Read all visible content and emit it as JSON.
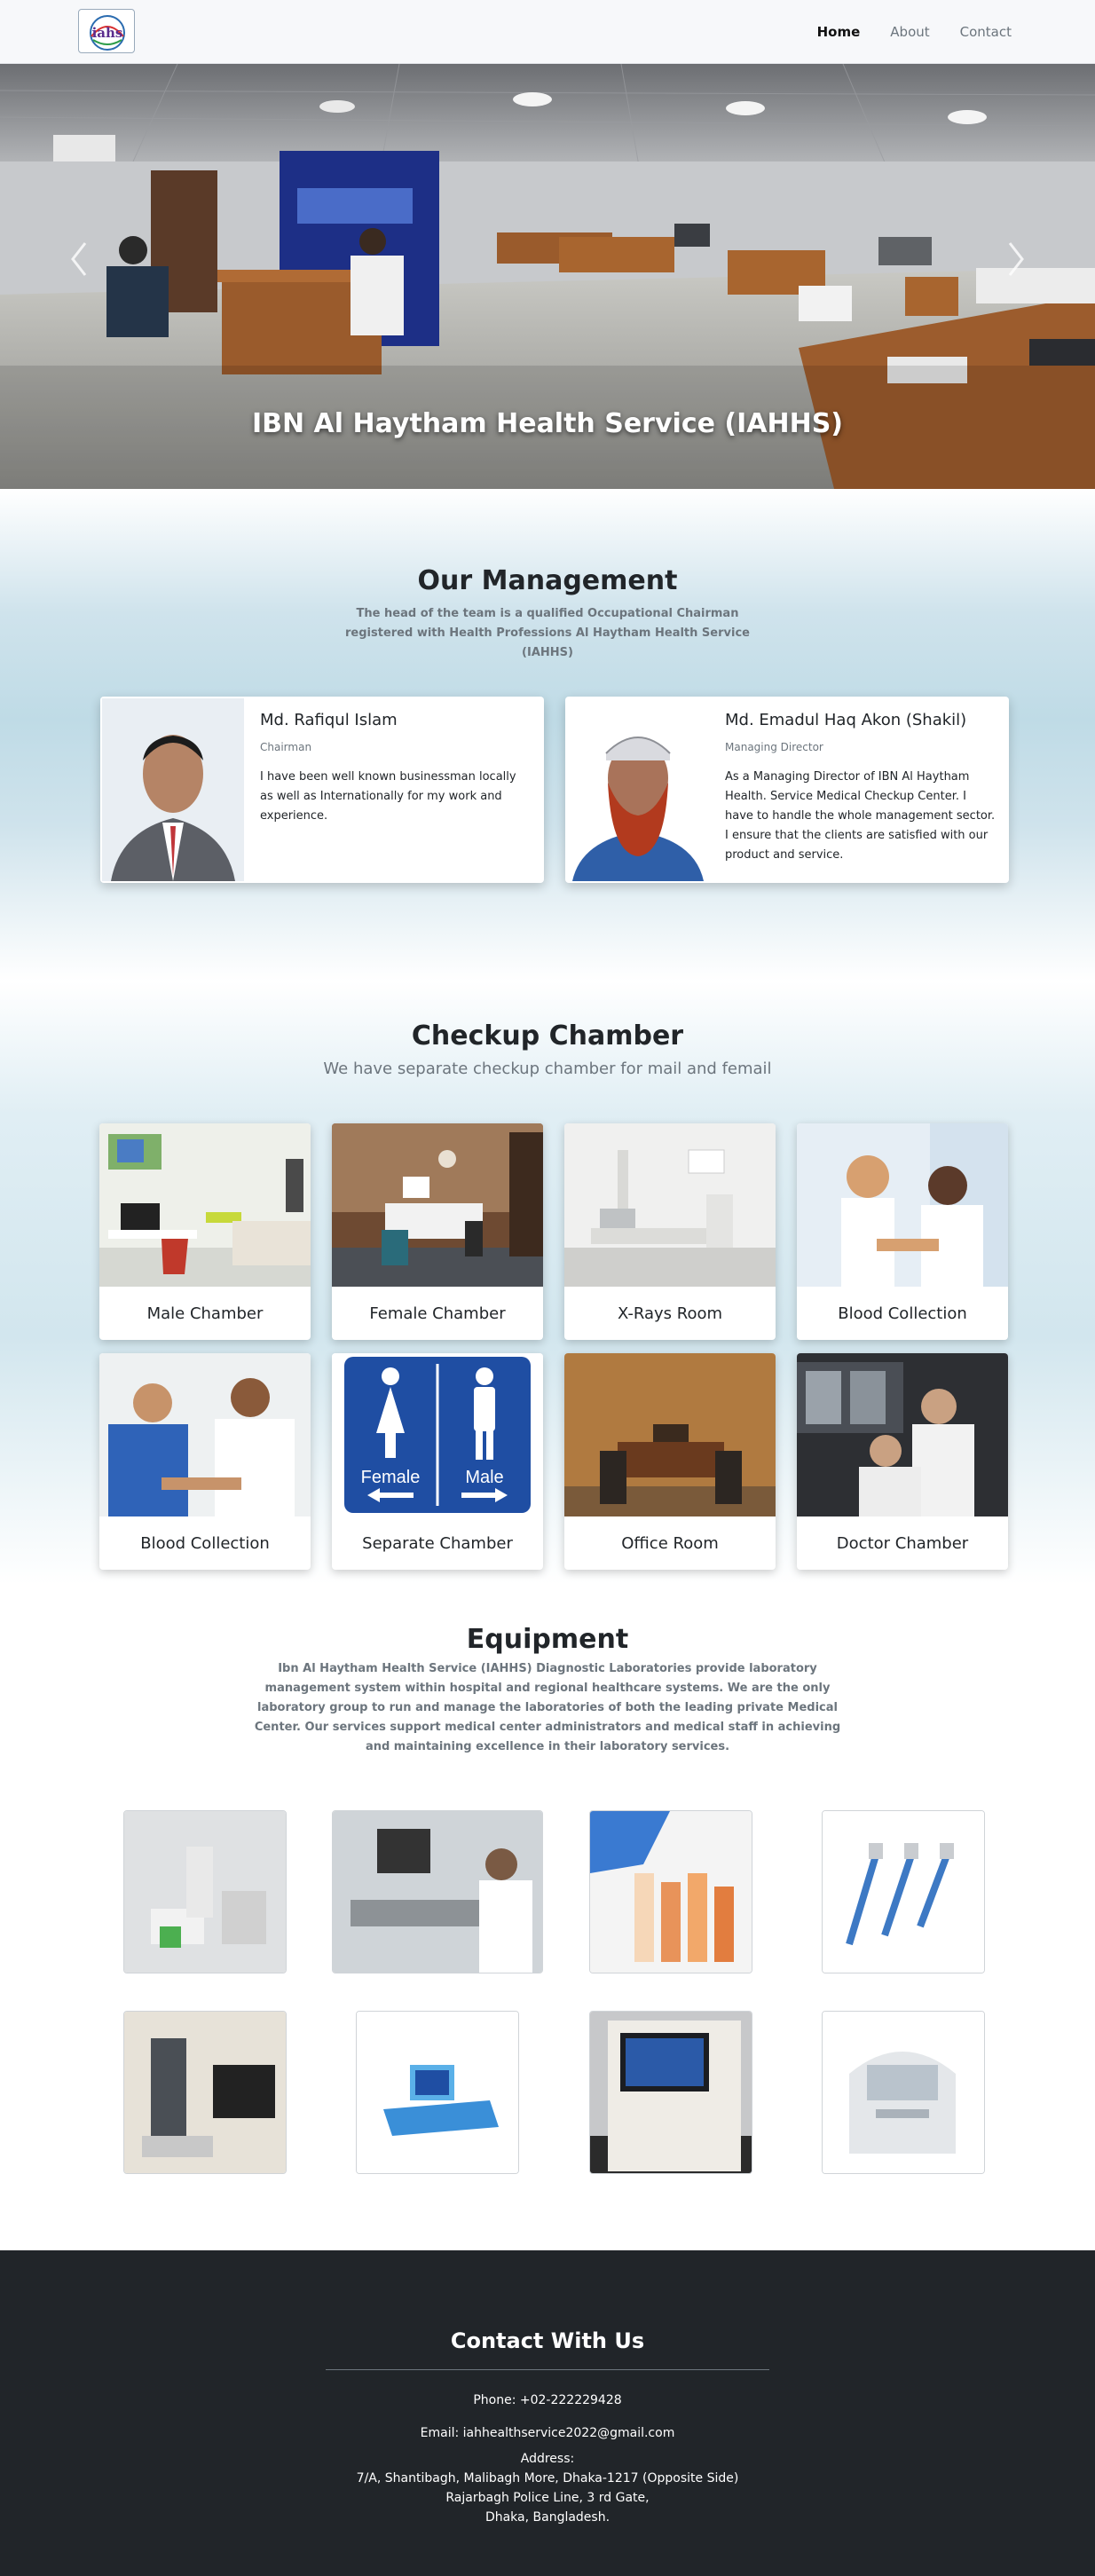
{
  "nav": {
    "logo_text": "iahs",
    "links": [
      {
        "label": "Home",
        "active": true
      },
      {
        "label": "About",
        "active": false
      },
      {
        "label": "Contact",
        "active": false
      }
    ]
  },
  "hero": {
    "caption": "IBN Al Haytham Health Service (IAHHS)",
    "prev_icon": "chevron-left-icon",
    "next_icon": "chevron-right-icon"
  },
  "management": {
    "title": "Our Management",
    "subtitle": "The head of the team is a qualified Occupational Chairman registered with Health Professions Al Haytham Health Service (IAHHS)",
    "members": [
      {
        "name": "Md. Rafiqul Islam",
        "role": "Chairman",
        "description": "I have been well known businessman locally as well as Internationally for my work and experience."
      },
      {
        "name": "Md. Emadul Haq Akon (Shakil)",
        "role": "Managing Director",
        "description": "As a Managing Director of IBN Al Haytham Health. Service Medical Checkup Center. I have to handle the whole management sector. I ensure that the clients are satisfied with our product and service."
      }
    ]
  },
  "checkup": {
    "title": "Checkup Chamber",
    "subtitle": "We have separate checkup chamber for mail and femail",
    "chambers": [
      {
        "label": "Male Chamber"
      },
      {
        "label": "Female Chamber"
      },
      {
        "label": "X-Rays Room"
      },
      {
        "label": "Blood Collection"
      },
      {
        "label": "Blood Collection"
      },
      {
        "label": "Separate Chamber"
      },
      {
        "label": "Office Room"
      },
      {
        "label": "Doctor Chamber"
      }
    ],
    "sign_text": {
      "female": "Female",
      "male": "Male"
    }
  },
  "equipment": {
    "title": "Equipment",
    "description": "Ibn Al Haytham Health Service (IAHHS) Diagnostic Laboratories provide laboratory management system within hospital and regional healthcare systems. We are the only laboratory group to run and manage the laboratories of both the leading private Medical Center. Our services support medical center administrators and medical staff in achieving and maintaining excellence in their laboratory services."
  },
  "footer": {
    "title": "Contact With Us",
    "phone": "Phone: +02-222229428",
    "email": "Email: iahhealthservice2022@gmail.com",
    "address_label": "Address:",
    "address_lines": [
      "7/A, Shantibagh, Malibagh More, Dhaka-1217 (Opposite Side)",
      "Rajarbagh Police Line, 3 rd Gate,",
      "Dhaka, Bangladesh."
    ]
  },
  "colors": {
    "footer_bg": "#212529",
    "sign_blue": "#1f4ea3",
    "text_muted": "#6c757d"
  }
}
